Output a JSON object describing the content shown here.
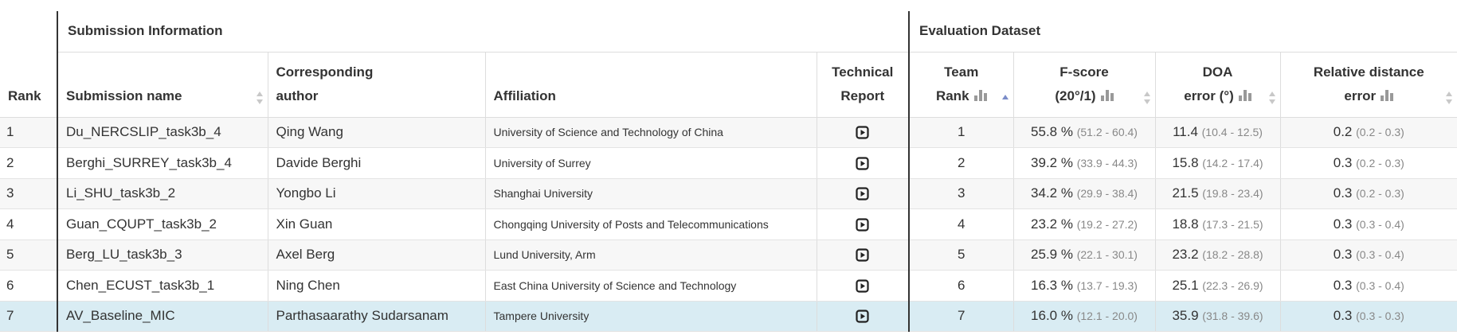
{
  "header": {
    "rank": "Rank",
    "group_submission": "Submission Information",
    "group_evaluation": "Evaluation Dataset",
    "submission_name": "Submission name",
    "author_line1": "Corresponding",
    "author_line2": "author",
    "affiliation": "Affiliation",
    "tech_line1": "Technical",
    "tech_line2": "Report",
    "team_line1": "Team",
    "team_line2": "Rank",
    "fscore_line1": "F-score",
    "fscore_line2": "(20°/1)",
    "doa_line1": "DOA",
    "doa_line2": "error (°)",
    "rd_line1": "Relative distance",
    "rd_line2": "error"
  },
  "rows": [
    {
      "rank": "1",
      "name": "Du_NERCSLIP_task3b_4",
      "author": "Qing Wang",
      "affiliation": "University of Science and Technology of China",
      "team_rank": "1",
      "fscore": "55.8 %",
      "fscore_ci": "(51.2 - 60.4)",
      "doa": "11.4",
      "doa_ci": "(10.4 - 12.5)",
      "rde": "0.2",
      "rde_ci": "(0.2 - 0.3)"
    },
    {
      "rank": "2",
      "name": "Berghi_SURREY_task3b_4",
      "author": "Davide Berghi",
      "affiliation": "University of Surrey",
      "team_rank": "2",
      "fscore": "39.2 %",
      "fscore_ci": "(33.9 - 44.3)",
      "doa": "15.8",
      "doa_ci": "(14.2 - 17.4)",
      "rde": "0.3",
      "rde_ci": "(0.2 - 0.3)"
    },
    {
      "rank": "3",
      "name": "Li_SHU_task3b_2",
      "author": "Yongbo Li",
      "affiliation": "Shanghai University",
      "team_rank": "3",
      "fscore": "34.2 %",
      "fscore_ci": "(29.9 - 38.4)",
      "doa": "21.5",
      "doa_ci": "(19.8 - 23.4)",
      "rde": "0.3",
      "rde_ci": "(0.2 - 0.3)"
    },
    {
      "rank": "4",
      "name": "Guan_CQUPT_task3b_2",
      "author": "Xin Guan",
      "affiliation": "Chongqing University of Posts and Telecommunications",
      "team_rank": "4",
      "fscore": "23.2 %",
      "fscore_ci": "(19.2 - 27.2)",
      "doa": "18.8",
      "doa_ci": "(17.3 - 21.5)",
      "rde": "0.3",
      "rde_ci": "(0.3 - 0.4)"
    },
    {
      "rank": "5",
      "name": "Berg_LU_task3b_3",
      "author": "Axel Berg",
      "affiliation": "Lund University, Arm",
      "team_rank": "5",
      "fscore": "25.9 %",
      "fscore_ci": "(22.1 - 30.1)",
      "doa": "23.2",
      "doa_ci": "(18.2 - 28.8)",
      "rde": "0.3",
      "rde_ci": "(0.3 - 0.4)"
    },
    {
      "rank": "6",
      "name": "Chen_ECUST_task3b_1",
      "author": "Ning Chen",
      "affiliation": "East China University of Science and Technology",
      "team_rank": "6",
      "fscore": "16.3 %",
      "fscore_ci": "(13.7 - 19.3)",
      "doa": "25.1",
      "doa_ci": "(22.3 - 26.9)",
      "rde": "0.3",
      "rde_ci": "(0.3 - 0.4)"
    },
    {
      "rank": "7",
      "name": "AV_Baseline_MIC",
      "author": "Parthasaarathy Sudarsanam",
      "affiliation": "Tampere University",
      "team_rank": "7",
      "fscore": "16.0 %",
      "fscore_ci": "(12.1 - 20.0)",
      "doa": "35.9",
      "doa_ci": "(31.8 - 39.6)",
      "rde": "0.3",
      "rde_ci": "(0.3 - 0.3)"
    }
  ],
  "highlight_color": "#d9ecf3"
}
